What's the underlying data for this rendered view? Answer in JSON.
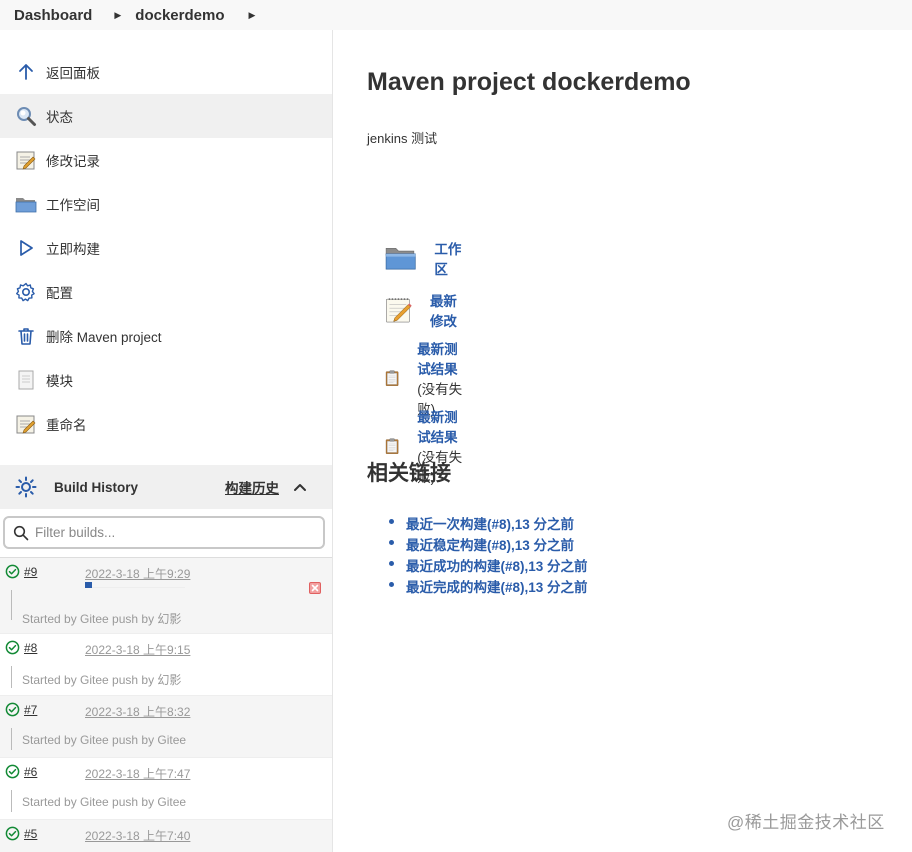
{
  "breadcrumb": {
    "items": [
      "Dashboard",
      "dockerdemo"
    ]
  },
  "sidebar": {
    "tasks": [
      {
        "label": "返回面板",
        "icon": "arrow-up-icon"
      },
      {
        "label": "状态",
        "icon": "magnifier-icon"
      },
      {
        "label": "修改记录",
        "icon": "notepad-icon"
      },
      {
        "label": "工作空间",
        "icon": "folder-icon"
      },
      {
        "label": "立即构建",
        "icon": "play-icon"
      },
      {
        "label": "配置",
        "icon": "gear-icon"
      },
      {
        "label": "删除 Maven project",
        "icon": "trash-icon"
      },
      {
        "label": "模块",
        "icon": "document-icon"
      },
      {
        "label": "重命名",
        "icon": "notepad-icon"
      }
    ]
  },
  "build_history": {
    "title": "Build History",
    "trend_label": "构建历史",
    "filter_placeholder": "Filter builds...",
    "builds": [
      {
        "number": "#9",
        "time": "2022-3-18 上午9:29",
        "cause": "Started by Gitee push by 幻影",
        "in_progress": true,
        "progress": 0.07
      },
      {
        "number": "#8",
        "time": "2022-3-18 上午9:15",
        "cause": "Started by Gitee push by 幻影"
      },
      {
        "number": "#7",
        "time": "2022-3-18 上午8:32",
        "cause": "Started by Gitee push by Gitee"
      },
      {
        "number": "#6",
        "time": "2022-3-18 上午7:47",
        "cause": "Started by Gitee push by Gitee"
      },
      {
        "number": "#5",
        "time": "2022-3-18 上午7:40",
        "cause": ""
      }
    ],
    "status_color": "#138a36"
  },
  "main": {
    "title": "Maven project dockerdemo",
    "description": "jenkins 测试",
    "links": [
      {
        "label": "工作区",
        "extra": "",
        "icon": "folder-icon"
      },
      {
        "label": "最新修改",
        "extra": "",
        "icon": "notepad-icon"
      },
      {
        "label": "最新测试结果",
        "extra": " (没有失败)",
        "icon": "clipboard-icon"
      },
      {
        "label": "最新测试结果",
        "extra": " (没有失败)",
        "icon": "clipboard-icon"
      }
    ],
    "related_title": "相关链接",
    "related_links": [
      "最近一次构建(#8),13 分之前",
      "最近稳定构建(#8),13 分之前",
      "最近成功的构建(#8),13 分之前",
      "最近完成的构建(#8),13 分之前"
    ]
  },
  "watermark": "@稀土掘金技术社区",
  "colors": {
    "link": "#2a5caa",
    "success": "#138a36",
    "sidebar_active": "#f0f0f0"
  }
}
